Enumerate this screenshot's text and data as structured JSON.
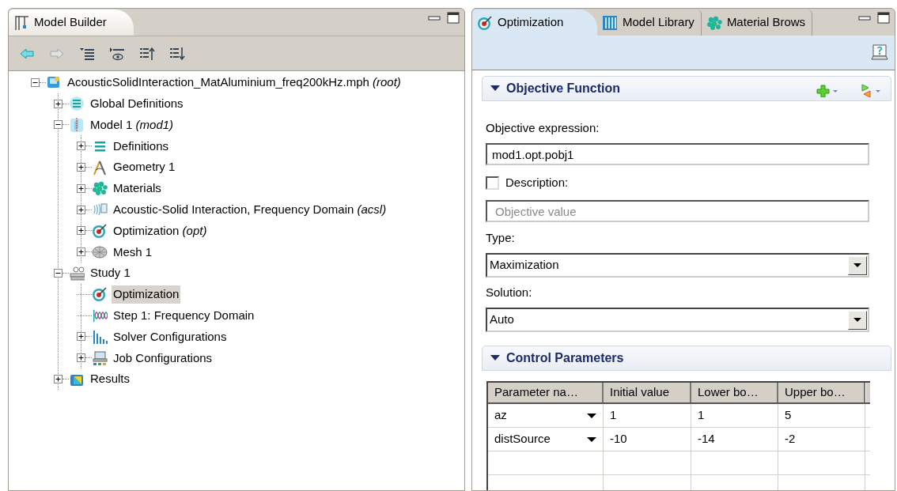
{
  "model_builder": {
    "tab": {
      "label": "Model Builder",
      "selected": true
    },
    "toolbar": [
      {
        "kind": "back",
        "disabled": false
      },
      {
        "kind": "forward",
        "disabled": true
      },
      {
        "kind": "show",
        "disabled": false
      },
      {
        "kind": "view",
        "disabled": false
      },
      {
        "kind": "collapse",
        "disabled": false
      },
      {
        "kind": "expand",
        "disabled": false
      }
    ],
    "tree": [
      {
        "label": "AcousticSolidInteraction_MatAluminium_freq200kHz.mph",
        "suffix": "(root)",
        "kind": "file",
        "expanded": true,
        "selected": false,
        "children": [
          {
            "label": "Global Definitions",
            "kind": "globals",
            "expanded": false,
            "selected": false
          },
          {
            "label": "Model 1",
            "suffix": "(mod1)",
            "kind": "model",
            "expanded": true,
            "selected": false,
            "children": [
              {
                "label": "Definitions",
                "kind": "definitions",
                "expanded": false,
                "selected": false
              },
              {
                "label": "Geometry 1",
                "kind": "geometry",
                "expanded": false,
                "selected": false
              },
              {
                "label": "Materials",
                "kind": "materials",
                "expanded": false,
                "selected": false
              },
              {
                "label": "Acoustic-Solid Interaction, Frequency Domain",
                "suffix": "(acsl)",
                "kind": "physics",
                "expanded": false,
                "selected": false
              },
              {
                "label": "Optimization",
                "suffix": "(opt)",
                "kind": "target",
                "expanded": false,
                "selected": false
              },
              {
                "label": "Mesh 1",
                "kind": "mesh",
                "expanded": false,
                "selected": false
              }
            ]
          },
          {
            "label": "Study 1",
            "kind": "study",
            "expanded": true,
            "selected": false,
            "children": [
              {
                "label": "Optimization",
                "kind": "target",
                "selected": true
              },
              {
                "label": "Step 1: Frequency Domain",
                "kind": "wave",
                "selected": false
              },
              {
                "label": "Solver Configurations",
                "kind": "solver",
                "expanded": false,
                "selected": false
              },
              {
                "label": "Job Configurations",
                "kind": "job",
                "expanded": false,
                "selected": false
              }
            ]
          },
          {
            "label": "Results",
            "kind": "results",
            "expanded": false,
            "selected": false
          }
        ]
      }
    ]
  },
  "settings": {
    "tabs": [
      {
        "label": "Optimization",
        "kind": "target",
        "selected": true
      },
      {
        "label": "Model Library",
        "kind": "library",
        "selected": false
      },
      {
        "label": "Material Brows",
        "kind": "materials",
        "selected": false
      }
    ],
    "objective_function": {
      "title": "Objective Function",
      "expanded": true,
      "expression_label": "Objective expression:",
      "expression": "mod1.opt.pobj1",
      "description_label": "Description:",
      "description_checked": false,
      "description_placeholder": "Objective value",
      "type_label": "Type:",
      "type": "Maximization",
      "solution_label": "Solution:",
      "solution": "Auto"
    },
    "control_parameters": {
      "title": "Control Parameters",
      "expanded": true,
      "columns": [
        "Parameter na…",
        "Initial value",
        "Lower bo…",
        "Upper bo…"
      ],
      "rows": [
        [
          "az",
          "1",
          "1",
          "5"
        ],
        [
          "distSource",
          "-10",
          "-14",
          "-2"
        ]
      ]
    }
  }
}
